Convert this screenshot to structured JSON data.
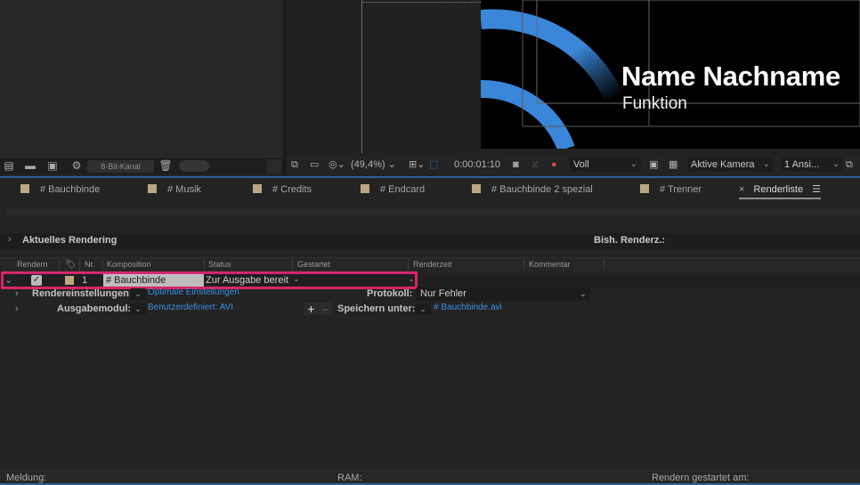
{
  "project_panel": {
    "bit_depth": "8-Bit-Kanal",
    "icons": [
      "interpret-footage-icon",
      "folder-icon",
      "new-composition-icon",
      "settings-icon",
      "trash-icon"
    ]
  },
  "viewer": {
    "comp_title": "Name Nachname",
    "comp_subtitle": "Funktion",
    "accent_color": "#3a86d8",
    "zoom": "(49,4%)",
    "timecode": "0:00:01:10",
    "resolution": "Voll",
    "camera": "Aktive Kamera",
    "views": "1 Ansi..."
  },
  "tabs": [
    {
      "label": "# Bauchbinde"
    },
    {
      "label": "# Musik"
    },
    {
      "label": "# Credits"
    },
    {
      "label": "# Endcard"
    },
    {
      "label": "# Bauchbinde 2 spezial"
    },
    {
      "label": "# Trenner"
    },
    {
      "label": "Renderliste",
      "active": true
    }
  ],
  "current_render": {
    "label": "Aktuelles Rendering",
    "elapsed_label": "Bish. Renderz.:"
  },
  "columns": [
    "Rendern",
    "Nr.",
    "Komposition",
    "Status",
    "Gestartet",
    "Renderzeit",
    "Kommentar"
  ],
  "render_item": {
    "checked": true,
    "number": "1",
    "composition": "# Bauchbinde",
    "status": "Zur Ausgabe bereit",
    "started": "-",
    "render_time": "-",
    "highlight_color": "#d6266a"
  },
  "render_settings": {
    "label": "Rendereinstellungen:",
    "value": "Optimale Einstellungen",
    "log_label": "Protokoll:",
    "log_value": "Nur Fehler"
  },
  "output_module": {
    "label": "Ausgabemodul:",
    "value": "Benutzerdefiniert: AVI",
    "save_label": "Speichern unter:",
    "save_value": "# Bauchbinde.avi",
    "plus": "+",
    "minus": "–"
  },
  "status_bar": {
    "message": "Meldung:",
    "ram": "RAM:",
    "render_started": "Rendern gestartet am:"
  }
}
